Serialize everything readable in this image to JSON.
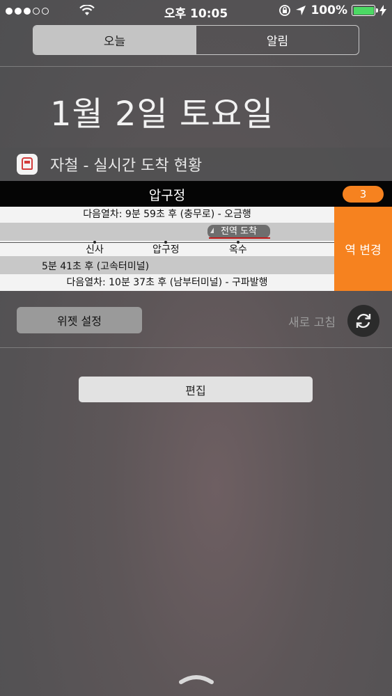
{
  "status_bar": {
    "time": "오후 10:05",
    "battery_percent": "100%",
    "signal_strength": 3,
    "icons": [
      "signal-dots-icon",
      "wifi-icon",
      "rotation-lock-icon",
      "location-arrow-icon",
      "battery-icon",
      "charging-bolt-icon"
    ],
    "battery_color": "#4cd964"
  },
  "segmented_control": {
    "tabs": [
      {
        "label": "오늘",
        "active": true
      },
      {
        "label": "알림",
        "active": false
      }
    ]
  },
  "date_header": "1월 2일 토요일",
  "widget": {
    "app_icon": "subway-train-icon",
    "title": "자철 - 실시간 도착 현황",
    "station": "압구정",
    "line_badge": "3",
    "accent_color": "#f6821f",
    "next_train_up": "다음열차: 9분 59초 후 (충무로) - 오금행",
    "arrival_chip": "전역 도착",
    "stations": [
      "신사",
      "압구정",
      "옥수"
    ],
    "down_train": "5분 41초 후 (고속터미널)",
    "next_train_down": "다음열차: 10분 37초 후 (남부터미널) - 구파발행",
    "change_station_label": "역 변경"
  },
  "controls": {
    "settings_label": "위젯 설정",
    "refresh_label": "새로 고침",
    "refresh_icon": "refresh-icon"
  },
  "edit_label": "편집",
  "bottom_handle_icon": "chevron-up-handle-icon"
}
